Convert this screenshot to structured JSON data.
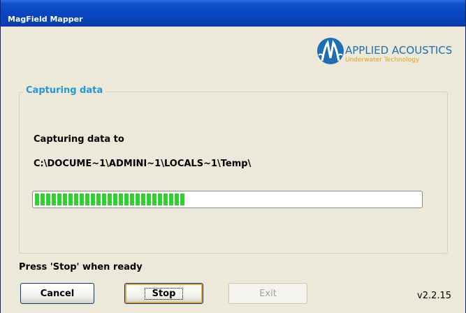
{
  "window": {
    "title": "MagField Mapper"
  },
  "logo": {
    "icon": "applied-acoustics-logo",
    "name": "APPLIED ACOUSTICS",
    "tagline": "Underwater Technology",
    "colors": {
      "mark": "#1c6fb4",
      "tagline": "#e0a21f"
    }
  },
  "capture": {
    "group_title": "Capturing data",
    "label": "Capturing data to",
    "path": "C:\\DOCUME~1\\ADMINI~1\\LOCALS~1\\Temp\\",
    "progress": 0.39,
    "progress_color": "#2fcf2f"
  },
  "footer": {
    "hint": "Press 'Stop' when ready",
    "version": "v2.2.15"
  },
  "buttons": {
    "cancel": "Cancel",
    "stop": "Stop",
    "exit": "Exit"
  }
}
